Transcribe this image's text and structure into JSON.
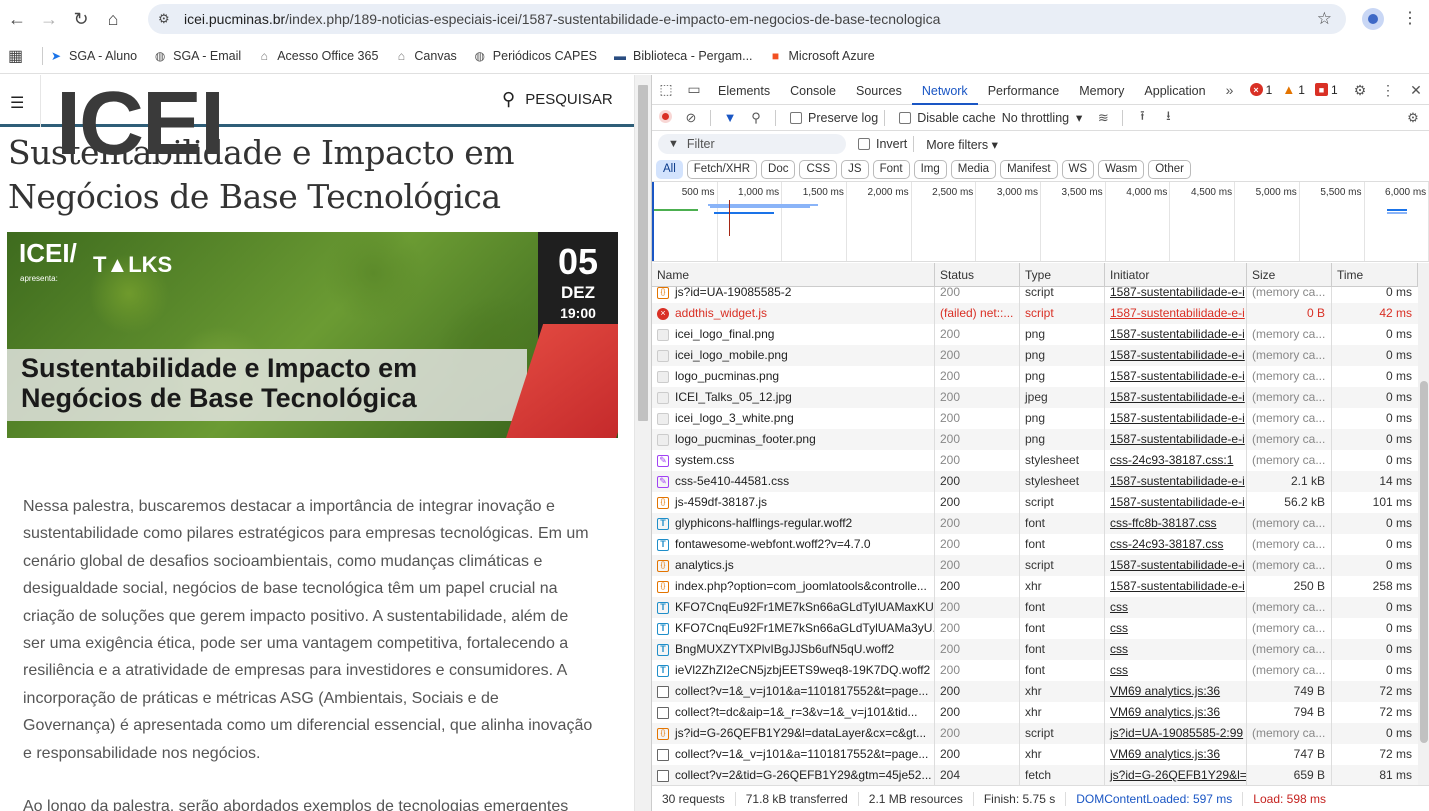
{
  "browser": {
    "url_host": "icei.pucminas.br",
    "url_path": "/index.php/189-noticias-especiais-icei/1587-sustentabilidade-e-impacto-em-negocios-de-base-tecnologica"
  },
  "bookmarks": [
    {
      "label": "SGA - Aluno",
      "icon": "sga-icon",
      "color": "#1a73e8"
    },
    {
      "label": "SGA - Email",
      "icon": "globe-icon",
      "color": "#555"
    },
    {
      "label": "Acesso Office 365",
      "icon": "building-icon",
      "color": "#777"
    },
    {
      "label": "Canvas",
      "icon": "building-icon",
      "color": "#777"
    },
    {
      "label": "Periódicos CAPES",
      "icon": "globe-icon",
      "color": "#555"
    },
    {
      "label": "Biblioteca - Pergam...",
      "icon": "camera-icon",
      "color": "#2a4c80"
    },
    {
      "label": "Microsoft Azure",
      "icon": "microsoft-icon",
      "color": "#f25022"
    }
  ],
  "page": {
    "search_label": "PESQUISAR",
    "logo": "ICEI",
    "title": "Sustentabilidade e Impacto em Negócios de Base Tecnológica",
    "banner": {
      "brand": "ICEI/",
      "talks": "T▲LKS",
      "apresenta": "apresenta:",
      "day": "05",
      "month": "DEZ",
      "time": "19:00",
      "title_line1": "Sustentabilidade e Impacto em",
      "title_line2": "Negócios de Base Tecnológica"
    },
    "body": "Nessa palestra, buscaremos destacar a importância de integrar inovação e sustentabilidade como pilares estratégicos para empresas tecnológicas. Em um cenário global de desafios socioambientais, como mudanças climáticas e desigualdade social, negócios de base tecnológica têm um papel crucial na criação de soluções que gerem impacto positivo. A sustentabilidade, além de ser uma exigência ética, pode ser uma vantagem competitiva, fortalecendo a resiliência e a atratividade de empresas para investidores e consumidores. A incorporação de práticas e métricas ASG (Ambientais, Sociais e de Governança) é apresentada como um diferencial essencial, que alinha inovação e responsabilidade nos negócios.",
    "body_next": "Ao longo da palestra, serão abordados exemplos de tecnologias emergentes"
  },
  "devtools": {
    "tabs": [
      "Elements",
      "Console",
      "Sources",
      "Network",
      "Performance",
      "Memory",
      "Application"
    ],
    "active_tab": "Network",
    "errors": "1",
    "warnings": "1",
    "issues": "1",
    "preserve_log": "Preserve log",
    "disable_cache": "Disable cache",
    "throttling": "No throttling",
    "filter_placeholder": "Filter",
    "invert": "Invert",
    "more_filters": "More filters",
    "types": [
      "All",
      "Fetch/XHR",
      "Doc",
      "CSS",
      "JS",
      "Font",
      "Img",
      "Media",
      "Manifest",
      "WS",
      "Wasm",
      "Other"
    ],
    "active_type": "All",
    "timeline_labels": [
      "500 ms",
      "1,000 ms",
      "1,500 ms",
      "2,000 ms",
      "2,500 ms",
      "3,000 ms",
      "3,500 ms",
      "4,000 ms",
      "4,500 ms",
      "5,000 ms",
      "5,500 ms",
      "6,000 ms"
    ],
    "columns": [
      "Name",
      "Status",
      "Type",
      "Initiator",
      "Size",
      "Time"
    ],
    "requests": [
      {
        "name": "js?id=UA-19085585-2",
        "status": "200",
        "type": "script",
        "initiator": "1587-sustentabilidade-e-i",
        "size": "(memory ca...",
        "time": "0 ms",
        "icon": "script"
      },
      {
        "name": "addthis_widget.js",
        "status": "(failed) net::...",
        "type": "script",
        "initiator": "1587-sustentabilidade-e-i",
        "size": "0 B",
        "time": "42 ms",
        "icon": "err",
        "failed": true
      },
      {
        "name": "icei_logo_final.png",
        "status": "200",
        "type": "png",
        "initiator": "1587-sustentabilidade-e-i",
        "size": "(memory ca...",
        "time": "0 ms",
        "icon": "img"
      },
      {
        "name": "icei_logo_mobile.png",
        "status": "200",
        "type": "png",
        "initiator": "1587-sustentabilidade-e-i",
        "size": "(memory ca...",
        "time": "0 ms",
        "icon": "img"
      },
      {
        "name": "logo_pucminas.png",
        "status": "200",
        "type": "png",
        "initiator": "1587-sustentabilidade-e-i",
        "size": "(memory ca...",
        "time": "0 ms",
        "icon": "img"
      },
      {
        "name": "ICEI_Talks_05_12.jpg",
        "status": "200",
        "type": "jpeg",
        "initiator": "1587-sustentabilidade-e-i",
        "size": "(memory ca...",
        "time": "0 ms",
        "icon": "img"
      },
      {
        "name": "icei_logo_3_white.png",
        "status": "200",
        "type": "png",
        "initiator": "1587-sustentabilidade-e-i",
        "size": "(memory ca...",
        "time": "0 ms",
        "icon": "img"
      },
      {
        "name": "logo_pucminas_footer.png",
        "status": "200",
        "type": "png",
        "initiator": "1587-sustentabilidade-e-i",
        "size": "(memory ca...",
        "time": "0 ms",
        "icon": "img"
      },
      {
        "name": "system.css",
        "status": "200",
        "type": "stylesheet",
        "initiator": "css-24c93-38187.css:1",
        "size": "(memory ca...",
        "time": "0 ms",
        "icon": "css"
      },
      {
        "name": "css-5e410-44581.css",
        "status": "200",
        "type": "stylesheet",
        "initiator": "1587-sustentabilidade-e-i",
        "size": "2.1 kB",
        "time": "14 ms",
        "icon": "css",
        "loaded": true
      },
      {
        "name": "js-459df-38187.js",
        "status": "200",
        "type": "script",
        "initiator": "1587-sustentabilidade-e-i",
        "size": "56.2 kB",
        "time": "101 ms",
        "icon": "script",
        "loaded": true
      },
      {
        "name": "glyphicons-halflings-regular.woff2",
        "status": "200",
        "type": "font",
        "initiator": "css-ffc8b-38187.css",
        "size": "(memory ca...",
        "time": "0 ms",
        "icon": "font"
      },
      {
        "name": "fontawesome-webfont.woff2?v=4.7.0",
        "status": "200",
        "type": "font",
        "initiator": "css-24c93-38187.css",
        "size": "(memory ca...",
        "time": "0 ms",
        "icon": "font"
      },
      {
        "name": "analytics.js",
        "status": "200",
        "type": "script",
        "initiator": "1587-sustentabilidade-e-i",
        "size": "(memory ca...",
        "time": "0 ms",
        "icon": "script"
      },
      {
        "name": "index.php?option=com_joomlatools&controlle...",
        "status": "200",
        "type": "xhr",
        "initiator": "1587-sustentabilidade-e-i",
        "size": "250 B",
        "time": "258 ms",
        "icon": "script",
        "loaded": true
      },
      {
        "name": "KFO7CnqEu92Fr1ME7kSn66aGLdTylUAMaxKU...",
        "status": "200",
        "type": "font",
        "initiator": "css",
        "size": "(memory ca...",
        "time": "0 ms",
        "icon": "font"
      },
      {
        "name": "KFO7CnqEu92Fr1ME7kSn66aGLdTylUAMa3yU...",
        "status": "200",
        "type": "font",
        "initiator": "css",
        "size": "(memory ca...",
        "time": "0 ms",
        "icon": "font"
      },
      {
        "name": "BngMUXZYTXPlvIBgJJSb6ufN5qU.woff2",
        "status": "200",
        "type": "font",
        "initiator": "css",
        "size": "(memory ca...",
        "time": "0 ms",
        "icon": "font"
      },
      {
        "name": "ieVl2ZhZI2eCN5jzbjEETS9weq8-19K7DQ.woff2",
        "status": "200",
        "type": "font",
        "initiator": "css",
        "size": "(memory ca...",
        "time": "0 ms",
        "icon": "font"
      },
      {
        "name": "collect?v=1&_v=j101&a=1101817552&t=page...",
        "status": "200",
        "type": "xhr",
        "initiator": "VM69 analytics.js:36",
        "size": "749 B",
        "time": "72 ms",
        "icon": "doc",
        "loaded": true
      },
      {
        "name": "collect?t=dc&aip=1&_r=3&v=1&_v=j101&tid...",
        "status": "200",
        "type": "xhr",
        "initiator": "VM69 analytics.js:36",
        "size": "794 B",
        "time": "72 ms",
        "icon": "doc",
        "loaded": true
      },
      {
        "name": "js?id=G-26QEFB1Y29&l=dataLayer&cx=c&gt...",
        "status": "200",
        "type": "script",
        "initiator": "js?id=UA-19085585-2:99",
        "size": "(memory ca...",
        "time": "0 ms",
        "icon": "script"
      },
      {
        "name": "collect?v=1&_v=j101&a=1101817552&t=page...",
        "status": "200",
        "type": "xhr",
        "initiator": "VM69 analytics.js:36",
        "size": "747 B",
        "time": "72 ms",
        "icon": "doc",
        "loaded": true
      },
      {
        "name": "collect?v=2&tid=G-26QEFB1Y29&gtm=45je52...",
        "status": "204",
        "type": "fetch",
        "initiator": "js?id=G-26QEFB1Y29&l=c",
        "size": "659 B",
        "time": "81 ms",
        "icon": "doc",
        "loaded": true
      }
    ],
    "summary": {
      "requests": "30 requests",
      "transferred": "71.8 kB transferred",
      "resources": "2.1 MB resources",
      "finish": "Finish: 5.75 s",
      "dcl": "DOMContentLoaded: 597 ms",
      "load": "Load: 598 ms"
    }
  }
}
